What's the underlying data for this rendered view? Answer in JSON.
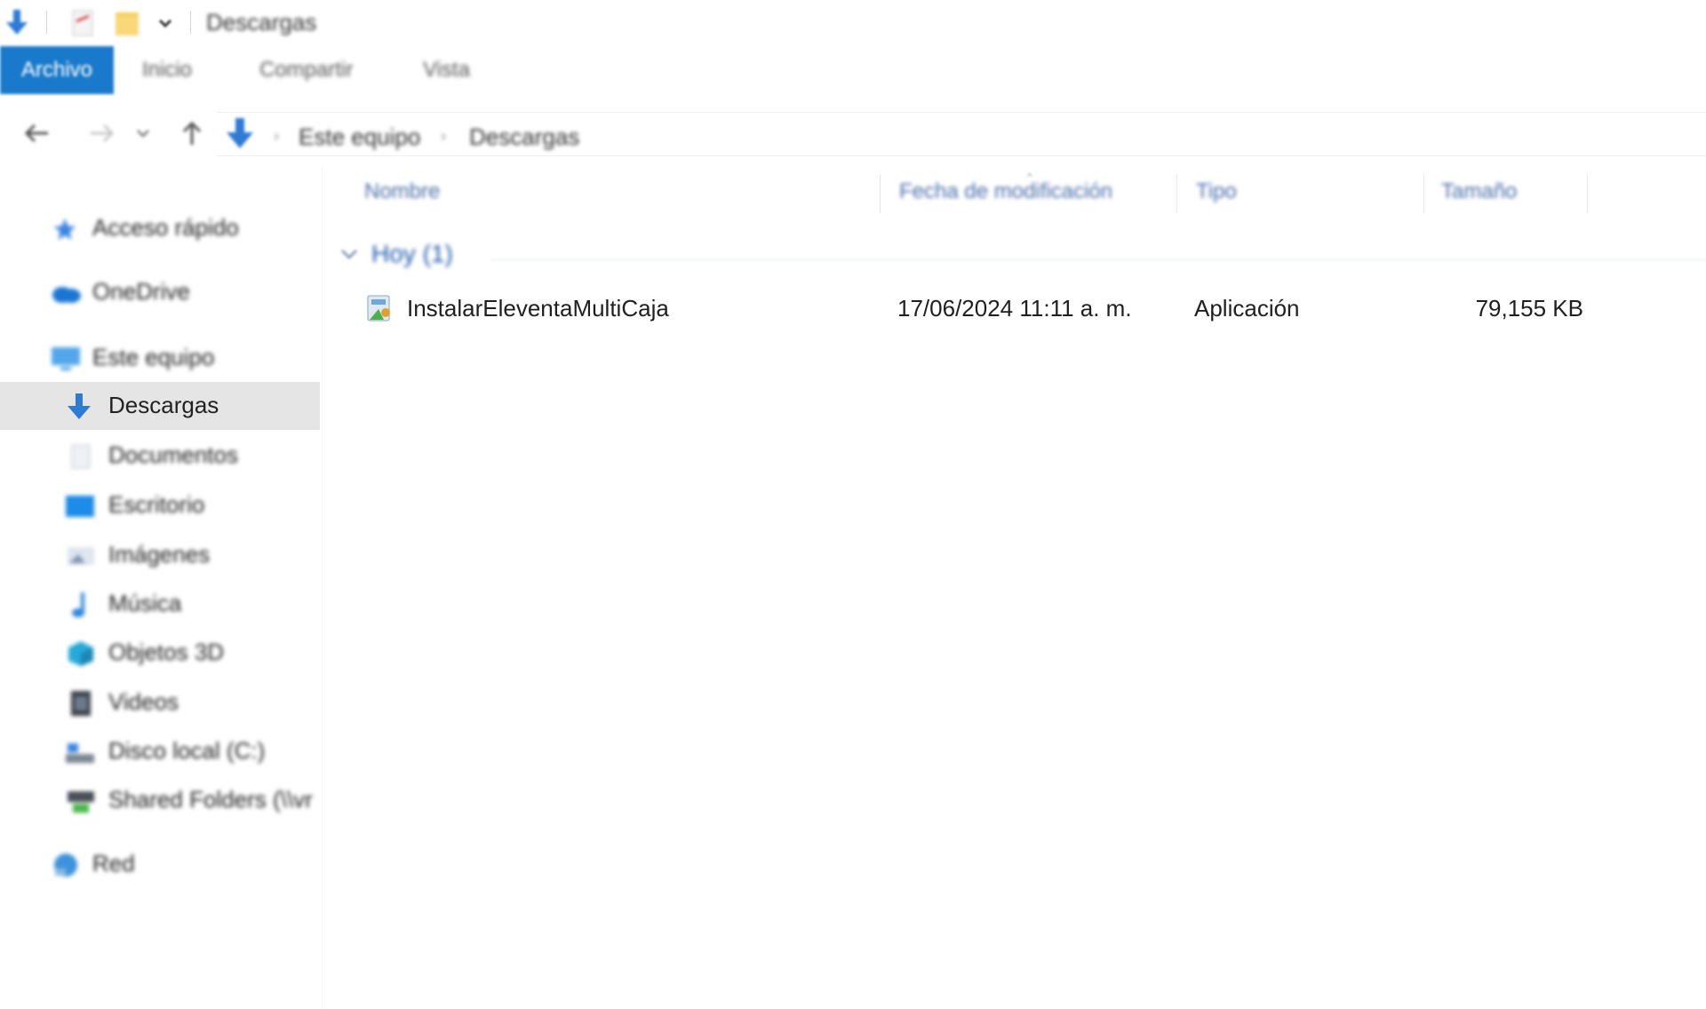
{
  "window": {
    "title": "Descargas"
  },
  "ribbon": {
    "tabs": [
      {
        "label": "Archivo"
      },
      {
        "label": "Inicio"
      },
      {
        "label": "Compartir"
      },
      {
        "label": "Vista"
      }
    ]
  },
  "address": {
    "crumbs": [
      "Este equipo",
      "Descargas"
    ]
  },
  "sidebar": {
    "items": [
      {
        "label": "Acceso rápido",
        "icon": "star-icon"
      },
      {
        "label": "OneDrive",
        "icon": "cloud-icon"
      },
      {
        "label": "Este equipo",
        "icon": "computer-icon"
      },
      {
        "label": "Descargas",
        "icon": "download-arrow-icon"
      },
      {
        "label": "Documentos",
        "icon": "document-icon"
      },
      {
        "label": "Escritorio",
        "icon": "desktop-icon"
      },
      {
        "label": "Imágenes",
        "icon": "image-icon"
      },
      {
        "label": "Música",
        "icon": "music-note-icon"
      },
      {
        "label": "Objetos 3D",
        "icon": "cube-icon"
      },
      {
        "label": "Videos",
        "icon": "film-icon"
      },
      {
        "label": "Disco local (C:)",
        "icon": "drive-icon"
      },
      {
        "label": "Shared Folders (\\\\vr",
        "icon": "network-drive-icon"
      },
      {
        "label": "Red",
        "icon": "network-icon"
      }
    ],
    "selected": "Descargas"
  },
  "content": {
    "columns": [
      {
        "label": "Nombre"
      },
      {
        "label": "Fecha de modificación"
      },
      {
        "label": "Tipo"
      },
      {
        "label": "Tamaño"
      }
    ],
    "group": {
      "label": "Hoy (1)"
    },
    "files": [
      {
        "name": "InstalarEleventaMultiCaja",
        "modified": "17/06/2024 11:11 a. m.",
        "type": "Aplicación",
        "size": "79,155 KB",
        "icon": "installer-icon"
      }
    ]
  },
  "colors": {
    "accent": "#1979ca",
    "selection": "#e5e5e5",
    "header_text": "#4a6ea9",
    "group_text": "#1e5aa8"
  }
}
